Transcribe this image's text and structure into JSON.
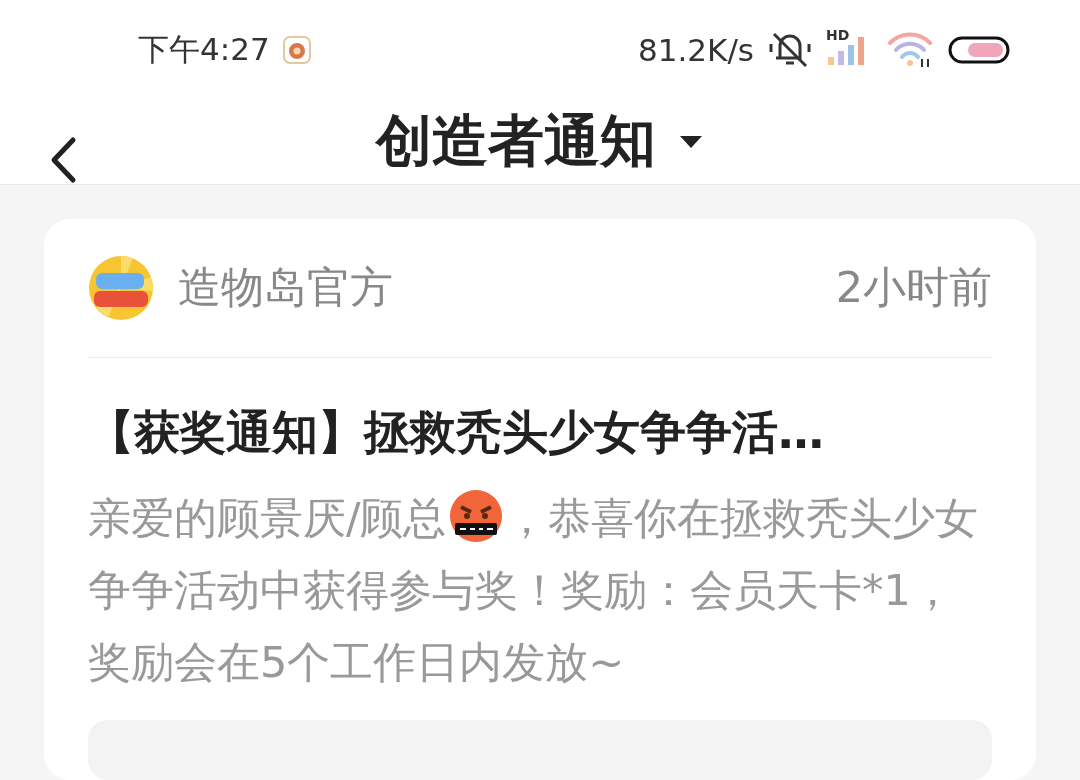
{
  "status_bar": {
    "time": "下午4:27",
    "net_speed": "81.2K/s",
    "signal_label": "HD"
  },
  "header": {
    "title": "创造者通知"
  },
  "notice": {
    "author": "造物岛官方",
    "time": "2小时前",
    "title": "【获奖通知】拯救秃头少女争争活…",
    "body": [
      {
        "kind": "text",
        "text": "亲爱的顾景厌/顾总"
      },
      {
        "kind": "emoji"
      },
      {
        "kind": "text",
        "text": "，恭喜你在拯救秃头少女争争活动中获得参与奖！奖励：会员天卡*1，奖励会在5个工作日内发放~"
      }
    ]
  }
}
